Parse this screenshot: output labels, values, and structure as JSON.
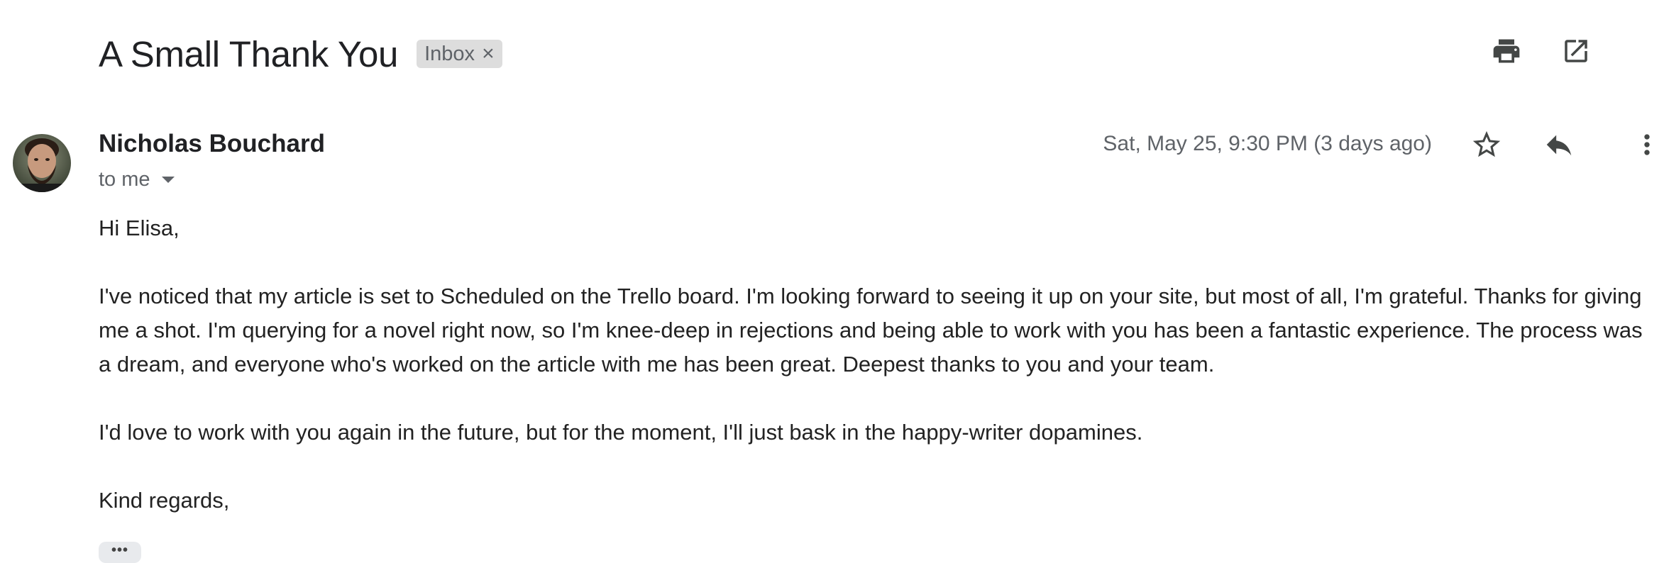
{
  "subject": "A Small Thank You",
  "label": {
    "text": "Inbox",
    "remove_glyph": "×"
  },
  "toolbar": {
    "print_icon": "print-icon",
    "open_new_window_icon": "open-in-new-window-icon"
  },
  "message": {
    "sender_name": "Nicholas Bouchard",
    "recipient": "to me",
    "date": "Sat, May 25, 9:30 PM (3 days ago)",
    "actions": [
      "star-icon",
      "reply-icon",
      "more-vert-icon"
    ],
    "body": [
      "Hi Elisa,",
      "I've noticed that my article is set to Scheduled on the Trello board. I'm looking forward to seeing it up on your site, but most of all, I'm grateful. Thanks for giving me a shot. I'm querying for a novel right now, so I'm knee-deep in rejections and being able to work with you has been a fantastic experience. The process was a dream, and everyone who's worked on the article with me has been great. Deepest thanks to you and your team.",
      "I'd love to work with you again in the future, but for the moment, I'll just bask in the happy-writer dopamines.",
      "Kind regards,"
    ],
    "trimmed_content_glyph": "•••"
  },
  "colors": {
    "text_primary": "#202124",
    "text_secondary": "#5f6368",
    "icon": "#444746",
    "label_bg": "#dddddd"
  }
}
